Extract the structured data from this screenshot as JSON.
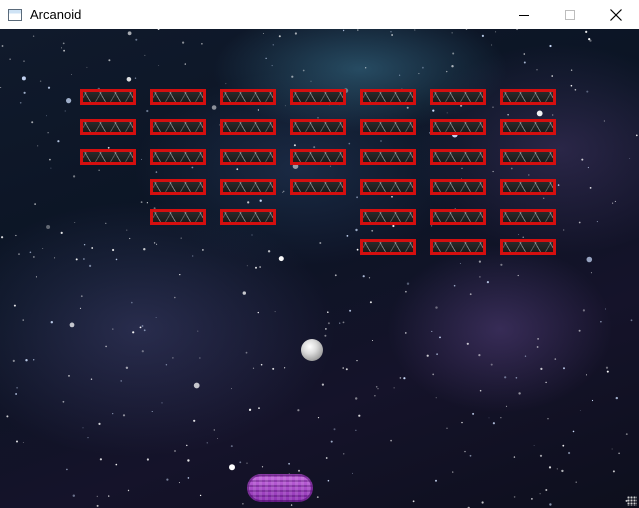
{
  "window": {
    "title": "Arcanoid",
    "icon": "app-window-icon",
    "controls": [
      "minimize-icon",
      "maximize-icon",
      "close-icon"
    ]
  },
  "game": {
    "background": "starfield-nebula",
    "brick_border_color": "#d40f0f",
    "paddle_color": "#b04fd0",
    "brick_grid": {
      "columns": 7,
      "rows": 6,
      "cells": [
        [
          1,
          1,
          1,
          1,
          1,
          1,
          1
        ],
        [
          1,
          1,
          1,
          1,
          1,
          1,
          1
        ],
        [
          1,
          1,
          1,
          1,
          1,
          1,
          1
        ],
        [
          0,
          1,
          1,
          1,
          1,
          1,
          1
        ],
        [
          0,
          1,
          1,
          0,
          1,
          1,
          1
        ],
        [
          0,
          0,
          0,
          0,
          1,
          1,
          1
        ]
      ]
    }
  }
}
